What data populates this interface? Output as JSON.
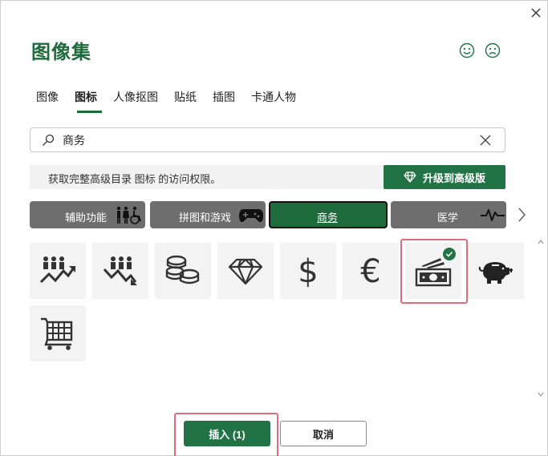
{
  "dialog": {
    "title": "图像集",
    "close_icon": "close-icon",
    "feedback": {
      "smile_icon": "smile-icon",
      "frown_icon": "frown-icon"
    }
  },
  "tabs": [
    {
      "label": "图像",
      "active": false
    },
    {
      "label": "图标",
      "active": true
    },
    {
      "label": "人像抠图",
      "active": false
    },
    {
      "label": "贴纸",
      "active": false
    },
    {
      "label": "插图",
      "active": false
    },
    {
      "label": "卡通人物",
      "active": false
    }
  ],
  "search": {
    "value": "商务",
    "placeholder": ""
  },
  "banner": {
    "text": "获取完整高级目录 图标 的访问权限。",
    "upgrade_label": "升级到高级版"
  },
  "categories": [
    {
      "label": "辅助功能",
      "icon": "accessibility-icon",
      "active": false
    },
    {
      "label": "拼图和游戏",
      "icon": "gamepad-icon",
      "active": false
    },
    {
      "label": "商务",
      "icon": "",
      "active": true
    },
    {
      "label": "医学",
      "icon": "heartbeat-icon",
      "active": false
    }
  ],
  "icons": [
    {
      "name": "people-growth-icon",
      "selected": false
    },
    {
      "name": "people-decline-icon",
      "selected": false
    },
    {
      "name": "coins-icon",
      "selected": false
    },
    {
      "name": "diamond-icon",
      "selected": false
    },
    {
      "name": "dollar-icon",
      "selected": false
    },
    {
      "name": "euro-icon",
      "selected": false
    },
    {
      "name": "money-icon",
      "selected": true
    },
    {
      "name": "piggy-bank-icon",
      "selected": false
    },
    {
      "name": "shopping-cart-icon",
      "selected": false
    }
  ],
  "footer": {
    "insert_label": "插入 (1)",
    "cancel_label": "取消"
  },
  "colors": {
    "accent": "#217346",
    "title": "#1e6b3c",
    "category_bg": "#6e6e6e",
    "selection_outline": "#e06b7b"
  }
}
